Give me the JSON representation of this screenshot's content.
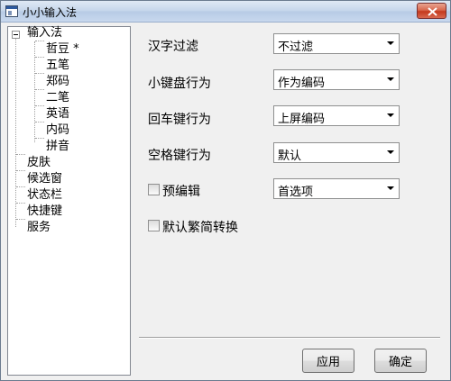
{
  "window": {
    "title": "小小输入法"
  },
  "tree": {
    "root": "输入法",
    "children": [
      "哲豆 *",
      "五笔",
      "郑码",
      "二笔",
      "英语",
      "内码",
      "拼音"
    ],
    "top_level": [
      "皮肤",
      "候选窗",
      "状态栏",
      "快捷键",
      "服务"
    ]
  },
  "form": {
    "rows": [
      {
        "label": "汉字过滤",
        "value": "不过滤"
      },
      {
        "label": "小键盘行为",
        "value": "作为编码"
      },
      {
        "label": "回车键行为",
        "value": "上屏编码"
      },
      {
        "label": "空格键行为",
        "value": "默认"
      },
      {
        "label": "预编辑",
        "value": "首选项",
        "checkbox": true,
        "checked": false
      }
    ],
    "extra_checkbox": {
      "label": "默认繁简转换",
      "checked": false
    }
  },
  "buttons": {
    "apply": "应用",
    "ok": "确定"
  }
}
